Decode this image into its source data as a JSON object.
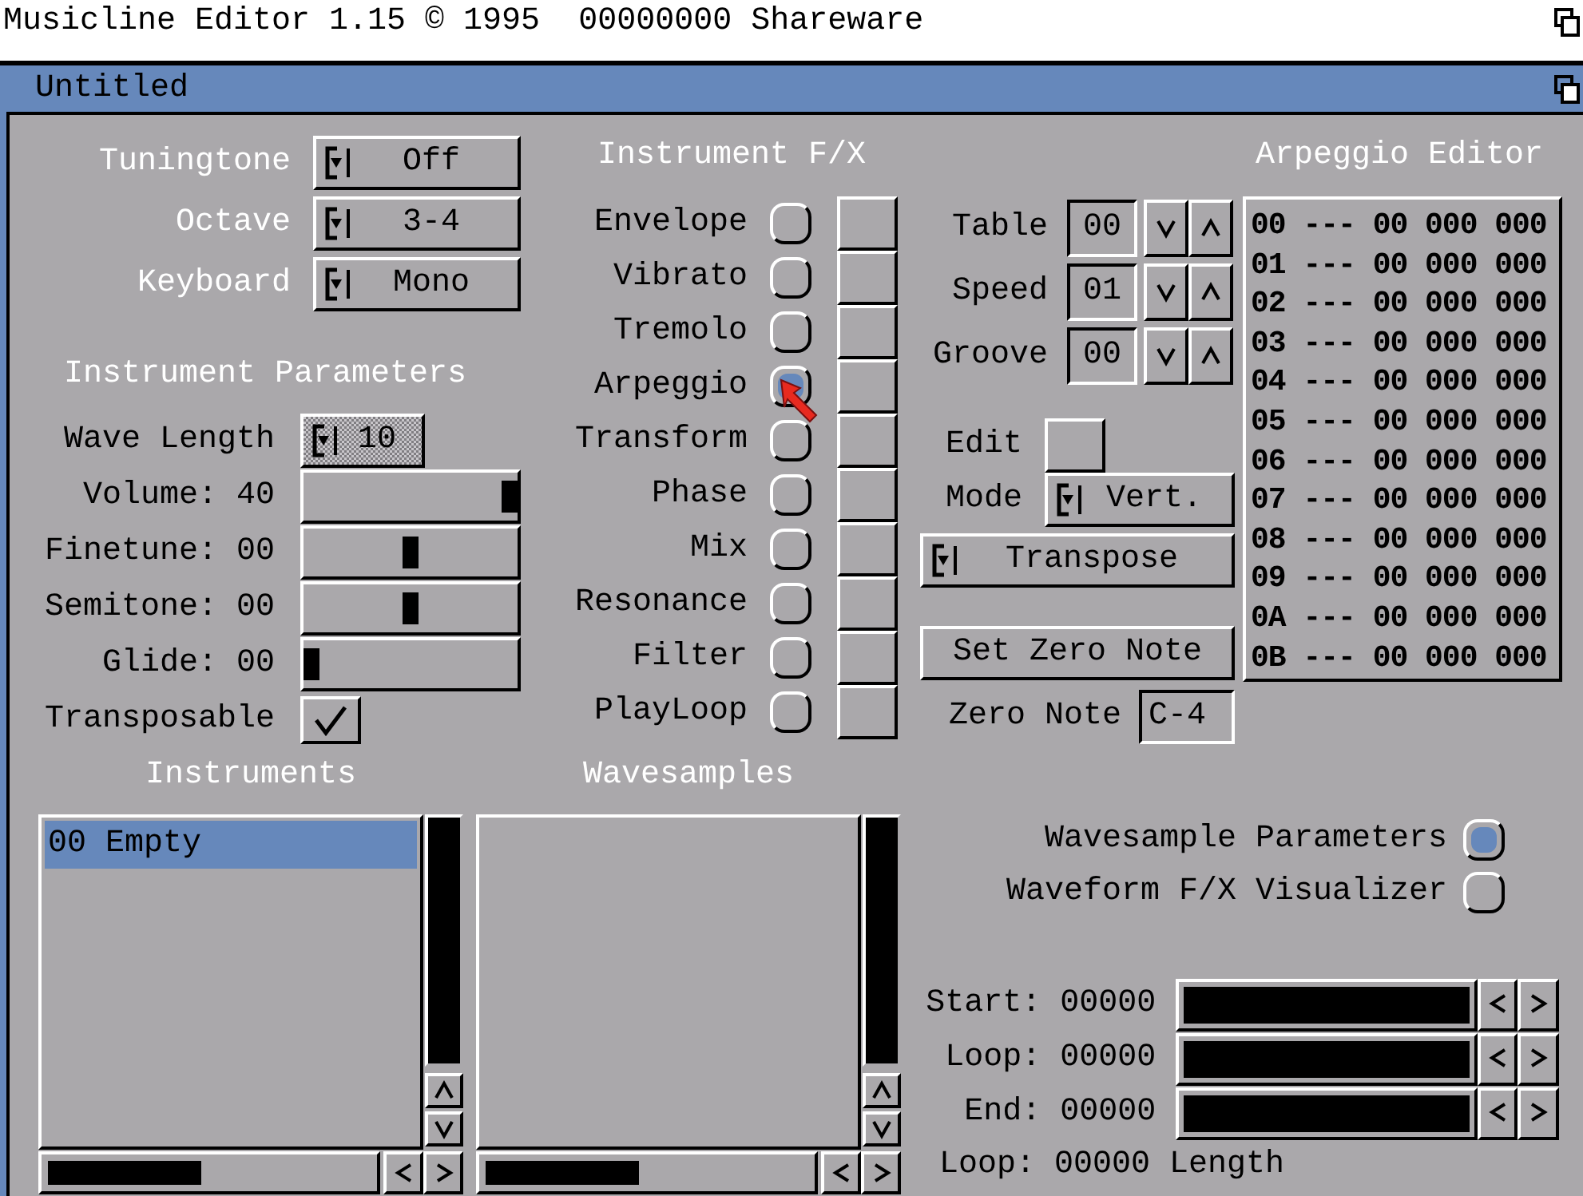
{
  "screen_title": {
    "name": "Musicline Editor 1.15 © 1995",
    "serial": "00000000 Shareware"
  },
  "window": {
    "title": "Untitled"
  },
  "cycle_settings": [
    {
      "label": "Tuningtone",
      "value": "Off"
    },
    {
      "label": "Octave",
      "value": "3-4"
    },
    {
      "label": "Keyboard",
      "value": "Mono"
    }
  ],
  "instrument_parameters": {
    "heading": "Instrument Parameters",
    "wave_length": {
      "label": "Wave Length",
      "value": "10",
      "disabled": true
    },
    "sliders": [
      {
        "label": "Volume: 40",
        "level": 1
      },
      {
        "label": "Finetune: 00",
        "level": 0.5
      },
      {
        "label": "Semitone: 00",
        "level": 0.5
      },
      {
        "label": "Glide: 00",
        "level": 0
      }
    ],
    "transposable": {
      "label": "Transposable",
      "checked": true
    }
  },
  "instrument_fx": {
    "heading": "Instrument F/X",
    "items": [
      {
        "label": "Envelope",
        "selected": false
      },
      {
        "label": "Vibrato",
        "selected": false
      },
      {
        "label": "Tremolo",
        "selected": false
      },
      {
        "label": "Arpeggio",
        "selected": true
      },
      {
        "label": "Transform",
        "selected": false
      },
      {
        "label": "Phase",
        "selected": false
      },
      {
        "label": "Mix",
        "selected": false
      },
      {
        "label": "Resonance",
        "selected": false
      },
      {
        "label": "Filter",
        "selected": false
      },
      {
        "label": "PlayLoop",
        "selected": false
      }
    ]
  },
  "arpeggio_editor": {
    "heading": "Arpeggio Editor",
    "steppers": [
      {
        "label": "Table",
        "value": "00"
      },
      {
        "label": "Speed",
        "value": "01"
      },
      {
        "label": "Groove",
        "value": "00"
      }
    ],
    "edit": {
      "label": "Edit"
    },
    "mode": {
      "label": "Mode",
      "value": "Vert."
    },
    "transpose": {
      "value": "Transpose"
    },
    "set_zero_note": "Set Zero Note",
    "zero_note": {
      "label": "Zero Note",
      "value": "C-4"
    },
    "rows": [
      "00 --- 00 000 000",
      "01 --- 00 000 000",
      "02 --- 00 000 000",
      "03 --- 00 000 000",
      "04 --- 00 000 000",
      "05 --- 00 000 000",
      "06 --- 00 000 000",
      "07 --- 00 000 000",
      "08 --- 00 000 000",
      "09 --- 00 000 000",
      "0A --- 00 000 000",
      "0B --- 00 000 000"
    ]
  },
  "instruments": {
    "heading": "Instruments",
    "items": [
      {
        "label": "00 Empty",
        "selected": true
      }
    ]
  },
  "wavesamples": {
    "heading": "Wavesamples"
  },
  "wavesample_panel": {
    "views": [
      {
        "label": "Wavesample Parameters",
        "selected": true
      },
      {
        "label": "Waveform F/X Visualizer",
        "selected": false
      }
    ],
    "positions": [
      {
        "label": "Start: 00000"
      },
      {
        "label": "Loop: 00000"
      },
      {
        "label": "End: 00000"
      }
    ],
    "loop_length": "Loop: 00000 Length"
  }
}
